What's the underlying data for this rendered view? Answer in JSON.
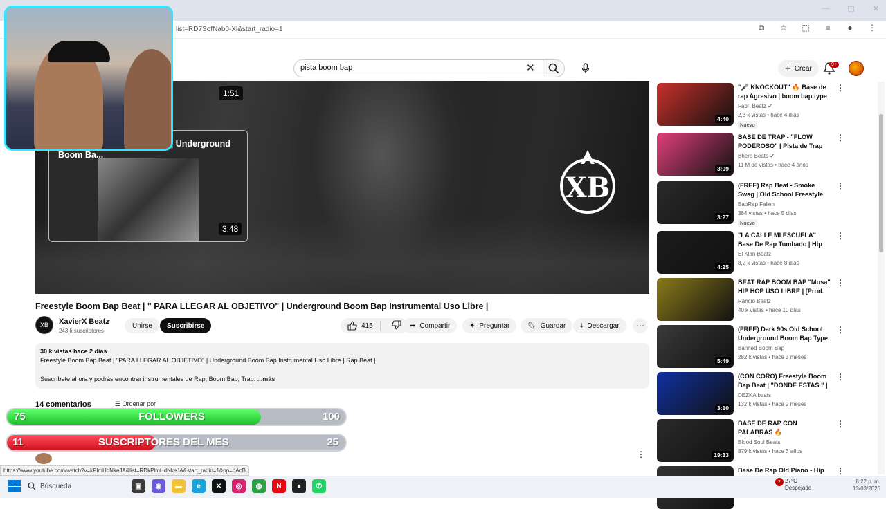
{
  "browser": {
    "address": "list=RD7SofNab0-Xl&start_radio=1",
    "status_url": "https://www.youtube.com/watch?v=kPlmHdNkeJA&list=RDkPlmHdNkeJA&start_radio=1&pp=oAcB"
  },
  "header": {
    "search_query": "pista boom bap",
    "create_label": "Crear",
    "notif_count": "9+"
  },
  "player": {
    "duration_badge": "1:51",
    "endcard_title": "\"APUESTO TODO POR MI\" | Underground Boom Ba...",
    "endcard_duration": "3:48",
    "logo_text": "XB"
  },
  "video": {
    "title": "Freestyle Boom Bap Beat | \" PARA LLEGAR AL OBJETIVO\" | Underground Boom Bap Instrumental Uso Libre |",
    "channel": "XavierX Beatz",
    "channel_avatar": "XB",
    "subs": "243 k suscriptores",
    "join_label": "Unirse",
    "subscribe_label": "Suscribirse",
    "likes": "415",
    "share_label": "Compartir",
    "ask_label": "Preguntar",
    "save_label": "Guardar",
    "download_label": "Descargar"
  },
  "description": {
    "meta": "30 k vistas  hace 2 días",
    "line1": "Freestyle Boom Bap Beat | \"PARA LLEGAR AL OBJETIVO\" | Underground Boom Bap Instrumental Uso Libre | Rap Beat |",
    "line2": "Suscríbete ahora y podrás encontrar instrumentales de Rap, Boom Bap, Trap.",
    "more": "...más"
  },
  "comments": {
    "count_label": "14 comentarios",
    "sort_label": "Ordenar por"
  },
  "overlays": {
    "followers": {
      "current": "75",
      "label": "FOLLOWERS",
      "goal": "100",
      "fraction": 0.75
    },
    "subs": {
      "current": "11",
      "label": "SUSCRIPTORES DEL MES",
      "goal": "25",
      "fraction": 0.44
    }
  },
  "sidebar": {
    "items": [
      {
        "title": "\"🎤 KNOCKOUT\" 🔥 Base de rap Agresivo | boom bap type ...",
        "channel": "Fabri Beatz ✔",
        "stats": "2,3 k vistas • hace 4 días",
        "badge": "Nuevo",
        "duration": "4:40",
        "thumb": "#c8302a"
      },
      {
        "title": "BASE DE TRAP - \"FLOW PODEROSO\" | Pista de Trap US...",
        "channel": "Bhera Beats ✔",
        "stats": "11 M de vistas • hace 4 años",
        "badge": "",
        "duration": "3:09",
        "thumb": "#e0407a"
      },
      {
        "title": "(FREE) Rap Beat - Smoke Swag | Old School Freestyle Boom Ba...",
        "channel": "BapRap Fallen",
        "stats": "384 vistas • hace 5 días",
        "badge": "Nuevo",
        "duration": "3:27",
        "thumb": "#2a2a2a"
      },
      {
        "title": "\"LA CALLE MI ESCUELA\" Base De Rap Tumbado | Hip Hop ...",
        "channel": "El Klan Beatz",
        "stats": "8,2 k vistas • hace 8 días",
        "badge": "",
        "duration": "4:25",
        "thumb": "#1c1c1c"
      },
      {
        "title": "BEAT RAP BOOM BAP \"Musa\" HIP HOP USO LIBRE | [Prod. ...",
        "channel": "Rancio Beatz",
        "stats": "40 k vistas • hace 10 días",
        "badge": "",
        "duration": "",
        "thumb": "#8a7a1a"
      },
      {
        "title": "(FREE) Dark 90s Old School Underground Boom Bap Type ...",
        "channel": "Banned Boom Bap",
        "stats": "282 k vistas • hace 3 meses",
        "badge": "",
        "duration": "5:49",
        "thumb": "#3a3a3a"
      },
      {
        "title": "(CON CORO) Freestyle Boom Bap Beat | \"DONDE ESTAS \" | ...",
        "channel": "DEZKA beats",
        "stats": "132 k vistas • hace 2 meses",
        "badge": "",
        "duration": "3:10",
        "thumb": "#1030a0"
      },
      {
        "title": "BASE DE RAP CON PALABRAS 🔥 ENTRENAMIENTO PARA ...",
        "channel": "Blood Soul Beats",
        "stats": "879 k vistas • hace 3 años",
        "badge": "",
        "duration": "19:33",
        "thumb": "#2a2a2a"
      },
      {
        "title": "Base De Rap Old Piano - Hip",
        "channel": "",
        "stats": "",
        "badge": "",
        "duration": "",
        "thumb": "#333333"
      }
    ]
  },
  "taskbar": {
    "search_label": "Búsqueda",
    "weather_temp": "27°C",
    "weather_desc": "Despejado",
    "weather_count": "2",
    "time": "8:22 p. m.",
    "date": "13/03/2026"
  }
}
